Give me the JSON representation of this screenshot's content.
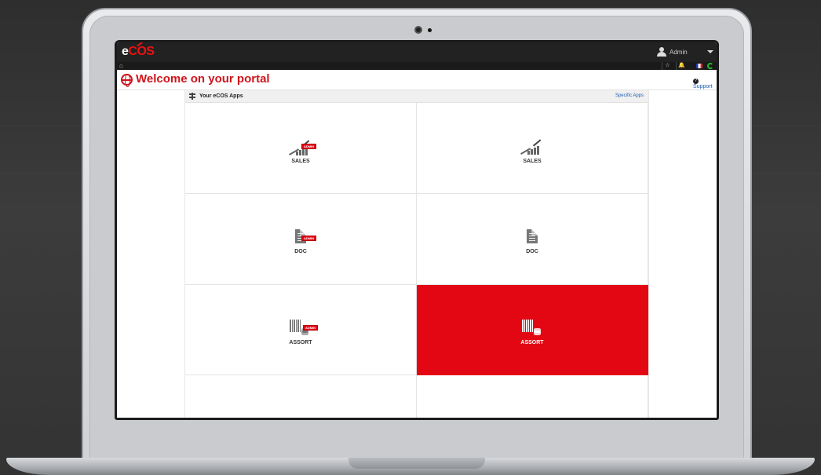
{
  "browser": {
    "app_logo": "eCOS",
    "user": {
      "name": "Admin"
    },
    "home_label": "⌂"
  },
  "header": {
    "title": "Welcome on your portal",
    "support_label": "Support"
  },
  "apps_panel": {
    "title": "Your eCOS Apps",
    "specific_apps_link": "Specific Apps"
  },
  "tiles": [
    {
      "label": "SALES",
      "icon": "sales-chart-icon",
      "admin_badge": "ADMIN",
      "active": false
    },
    {
      "label": "SALES",
      "icon": "sales-chart-icon",
      "admin_badge": "",
      "active": false
    },
    {
      "label": "DOC",
      "icon": "document-icon",
      "admin_badge": "ADMIN",
      "active": false
    },
    {
      "label": "DOC",
      "icon": "document-icon",
      "admin_badge": "",
      "active": false
    },
    {
      "label": "ASSORT",
      "icon": "barcode-database-icon",
      "admin_badge": "ADMIN",
      "active": false
    },
    {
      "label": "ASSORT",
      "icon": "barcode-database-icon",
      "admin_badge": "",
      "active": true
    }
  ],
  "colors": {
    "brand_red": "#e30613",
    "title_red": "#d0141c",
    "link_blue": "#1a5fb4",
    "topbar": "#222222"
  }
}
